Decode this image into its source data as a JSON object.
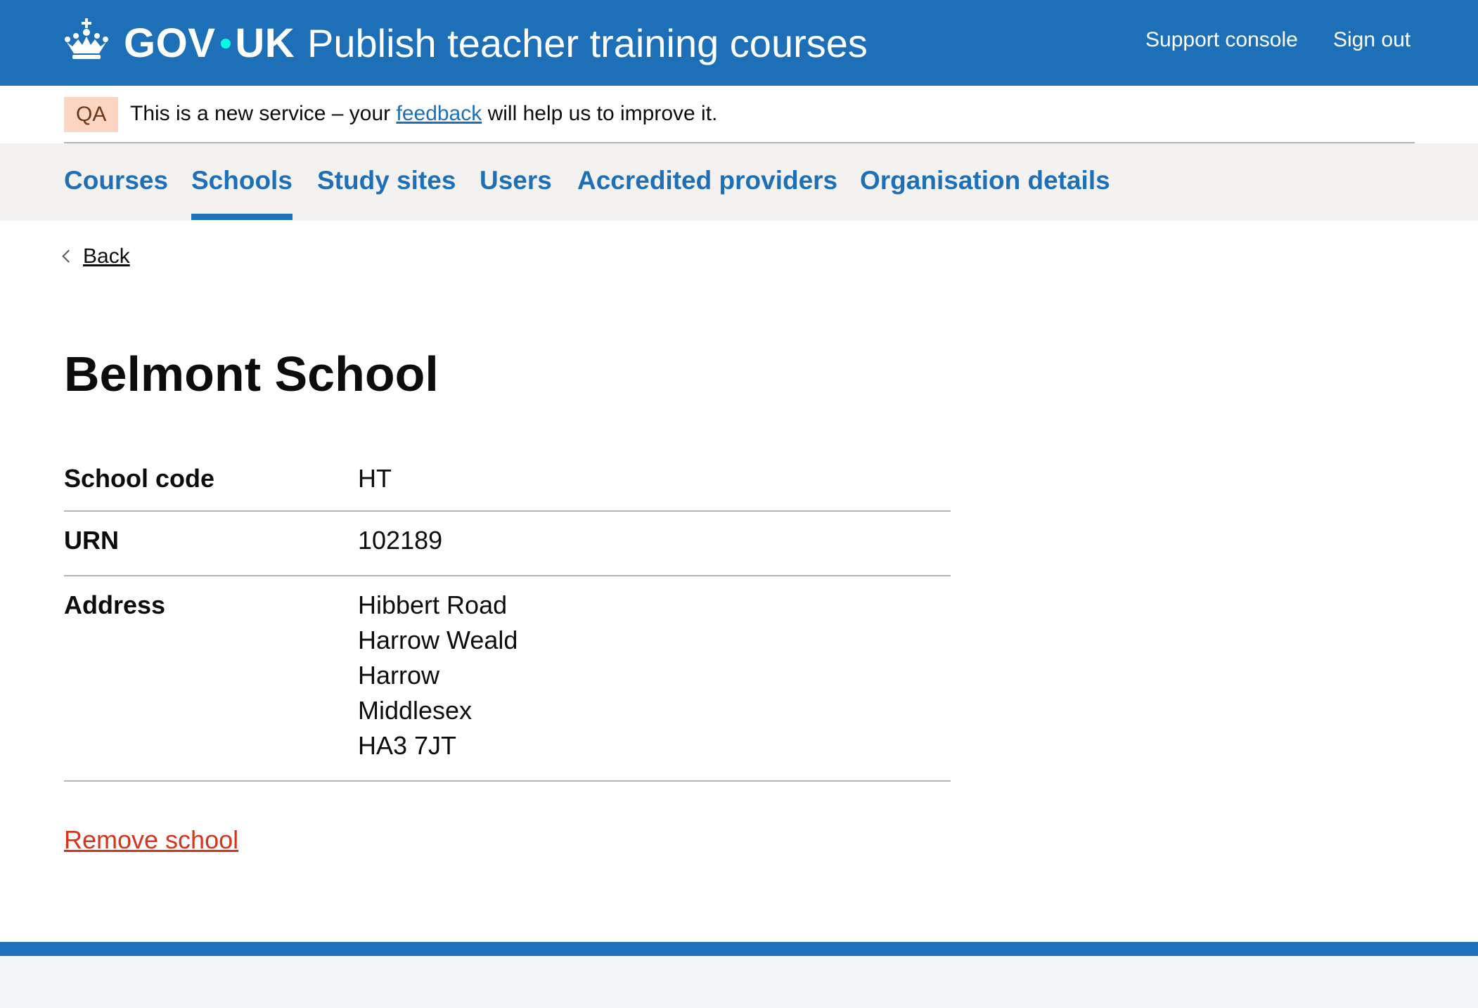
{
  "header": {
    "logo_text": "GOV",
    "logo_text_2": "UK",
    "service_name": "Publish teacher training courses",
    "links": [
      "Support console",
      "Sign out"
    ]
  },
  "phase_banner": {
    "tag": "QA",
    "text_before": "This is a new service – your ",
    "link": "feedback",
    "text_after": " will help us to improve it."
  },
  "subnav": {
    "items": [
      "Courses",
      "Schools",
      "Study sites",
      "Users",
      "Accredited providers",
      "Organisation details"
    ],
    "active": "Schools"
  },
  "back_label": "Back",
  "page_title": "Belmont School",
  "summary": [
    {
      "key": "School code",
      "value": "HT"
    },
    {
      "key": "URN",
      "value": "102189"
    },
    {
      "key": "Address",
      "lines": [
        "Hibbert Road",
        "Harrow Weald",
        "Harrow",
        "Middlesex",
        "HA3 7JT"
      ]
    }
  ],
  "remove_label": "Remove school",
  "colors": {
    "brand_blue": "#1d70b8",
    "link_red": "#d4351c",
    "tag_bg": "#fcd6c3"
  }
}
